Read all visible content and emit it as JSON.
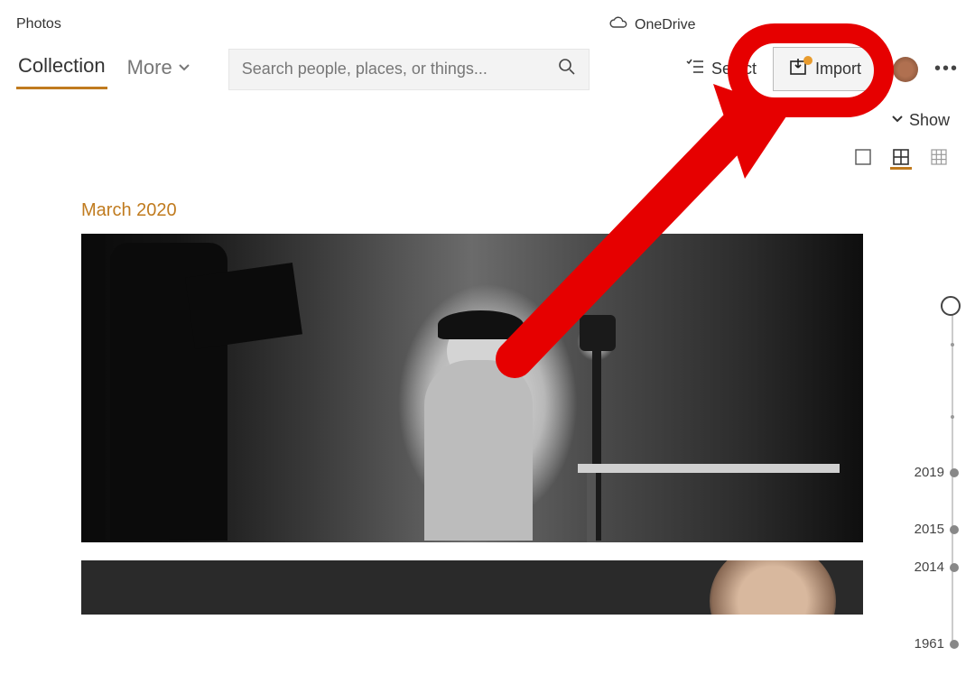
{
  "app": {
    "title": "Photos"
  },
  "header": {
    "onedrive_label": "OneDrive"
  },
  "tabs": {
    "collection": "Collection",
    "more": "More"
  },
  "search": {
    "placeholder": "Search people, places, or things..."
  },
  "toolbar": {
    "select_label": "Select",
    "import_label": "Import",
    "show_label": "Show"
  },
  "section": {
    "title": "March 2020"
  },
  "timeline": {
    "years": [
      "2019",
      "2015",
      "2014",
      "1961"
    ]
  }
}
